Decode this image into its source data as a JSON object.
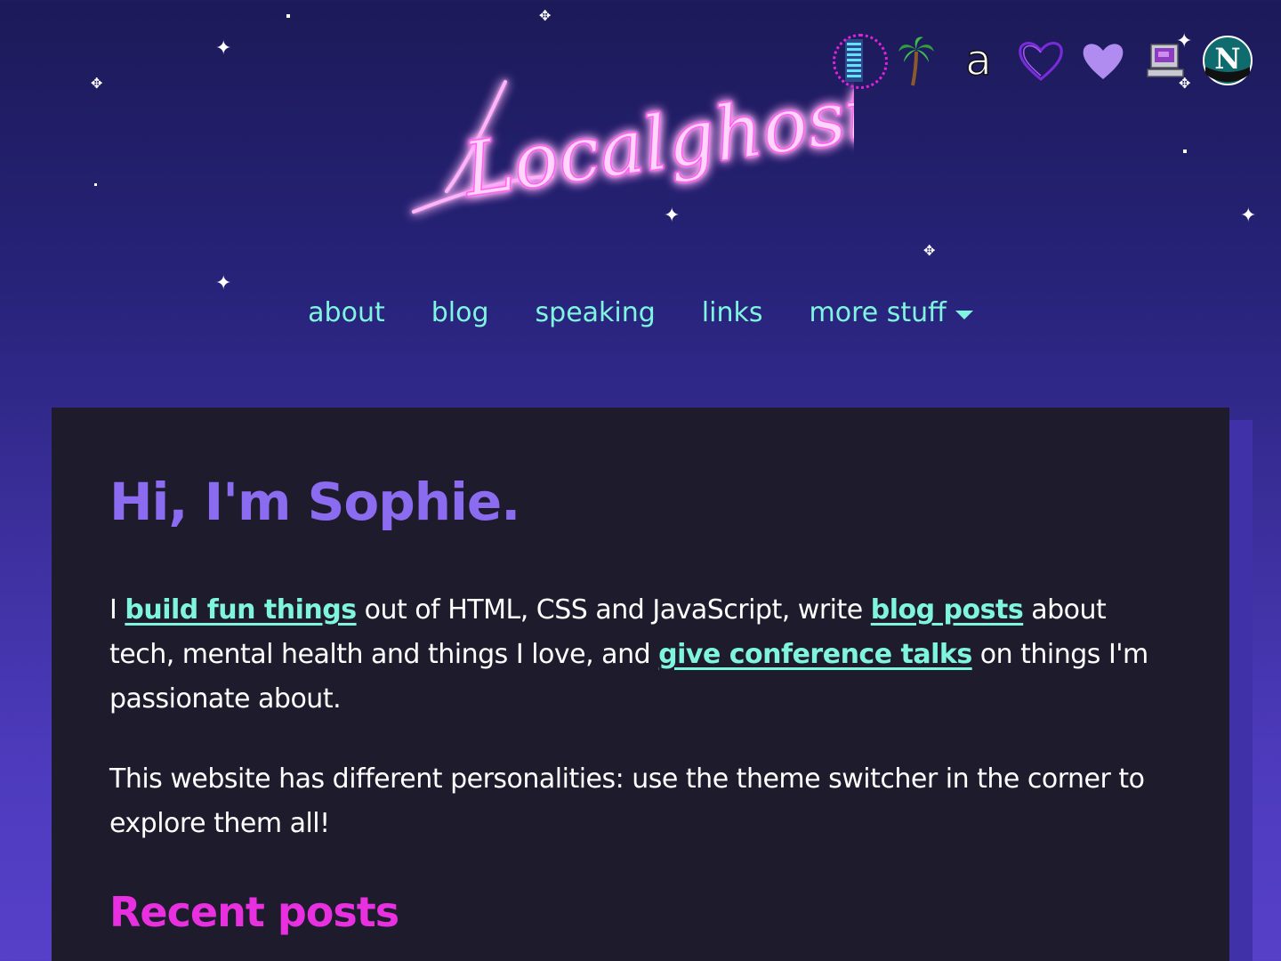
{
  "logo": {
    "text": "Localghost"
  },
  "theme_switcher": {
    "options": [
      {
        "icon": "server-rack-icon",
        "active": true
      },
      {
        "icon": "palm-tree-icon",
        "active": false
      },
      {
        "icon": "letter-a-icon",
        "glyph": "a",
        "active": false
      },
      {
        "icon": "heart-outline-icon",
        "active": false
      },
      {
        "icon": "heart-filled-icon",
        "active": false
      },
      {
        "icon": "retro-computer-icon",
        "active": false
      },
      {
        "icon": "netscape-icon",
        "glyph": "N",
        "active": false
      }
    ]
  },
  "nav": {
    "items": [
      {
        "label": "about"
      },
      {
        "label": "blog"
      },
      {
        "label": "speaking"
      },
      {
        "label": "links"
      },
      {
        "label": "more stuff",
        "icon": "caret-down-icon"
      }
    ]
  },
  "main": {
    "heading": "Hi, I'm Sophie.",
    "intro": {
      "t1": "I ",
      "link1": "build fun things",
      "t2": " out of HTML, CSS and JavaScript, write ",
      "link2": "blog posts",
      "t3": " about tech, mental health and things I love, and ",
      "link3": "give conference talks",
      "t4": " on things I'm passionate about."
    },
    "personalities": "This website has different personalities: use the theme switcher in the corner to explore them all!",
    "recent_heading": "Recent posts"
  },
  "colors": {
    "link": "#7ff5e0",
    "heading": "#8b6bf0",
    "accent_pink": "#e830e0",
    "card_bg": "#1e1c2c"
  }
}
